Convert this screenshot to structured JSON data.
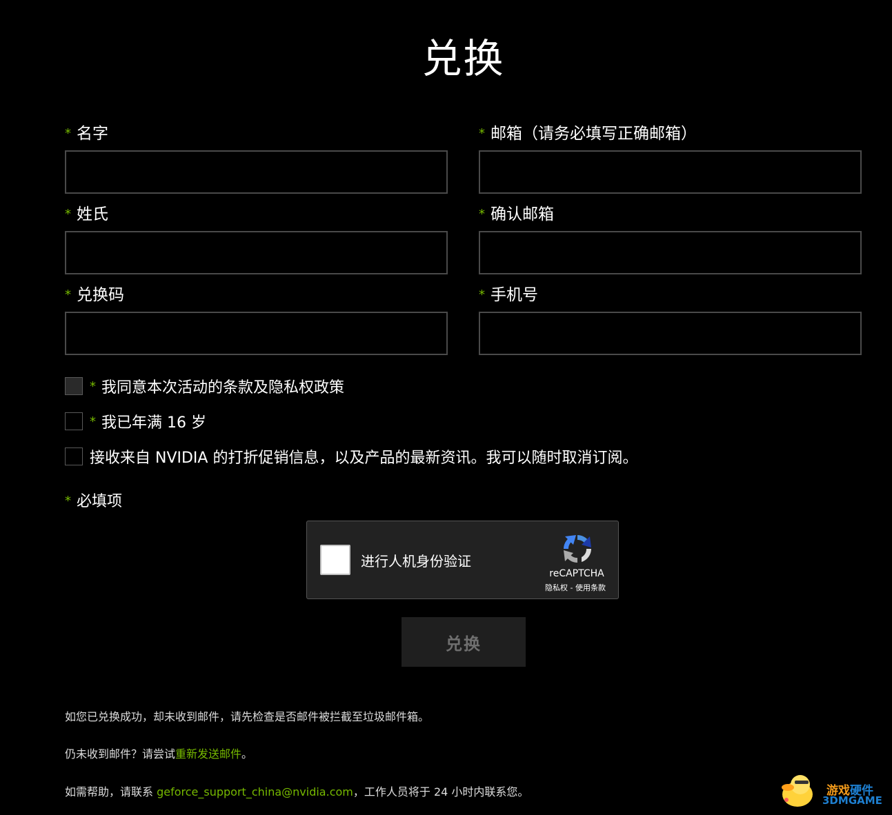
{
  "page": {
    "title": "兑换"
  },
  "form": {
    "required_mark": "*",
    "fields": [
      {
        "label": "名字"
      },
      {
        "label": "邮箱（请务必填写正确邮箱）"
      },
      {
        "label": "姓氏"
      },
      {
        "label": "确认邮箱"
      },
      {
        "label": "兑换码"
      },
      {
        "label": "手机号"
      }
    ],
    "checkboxes": [
      {
        "label": "我同意本次活动的条款及隐私权政策",
        "required": true,
        "checked": false
      },
      {
        "label": "我已年满 16 岁",
        "required": true,
        "checked": false
      },
      {
        "label": "接收来自 NVIDIA 的打折促销信息，以及产品的最新资讯。我可以随时取消订阅。",
        "required": false,
        "checked": false
      }
    ],
    "required_note": "必填项",
    "submit_label": "兑换"
  },
  "recaptcha": {
    "label": "进行人机身份验证",
    "brand": "reCAPTCHA",
    "privacy": "隐私权",
    "separator": "-",
    "terms": "使用条款"
  },
  "info": {
    "line1": "如您已兑换成功，却未收到邮件，请先检查是否邮件被拦截至垃圾邮件箱。",
    "line2_prefix": "仍未收到邮件？请尝试",
    "line2_link": "重新发送邮件",
    "line2_suffix": "。",
    "line3_prefix": "如需帮助，请联系 ",
    "line3_email": "geforce_support_china@nvidia.com",
    "line3_suffix": "，工作人员将于 24 小时内联系您。"
  },
  "watermark": {
    "text1_a": "游戏",
    "text1_b": "硬件",
    "text2": "3DMGAME"
  },
  "colors": {
    "accent": "#76b900",
    "background": "#000000",
    "input_border": "#4a4a4a",
    "button_bg": "#1f1f1f"
  }
}
